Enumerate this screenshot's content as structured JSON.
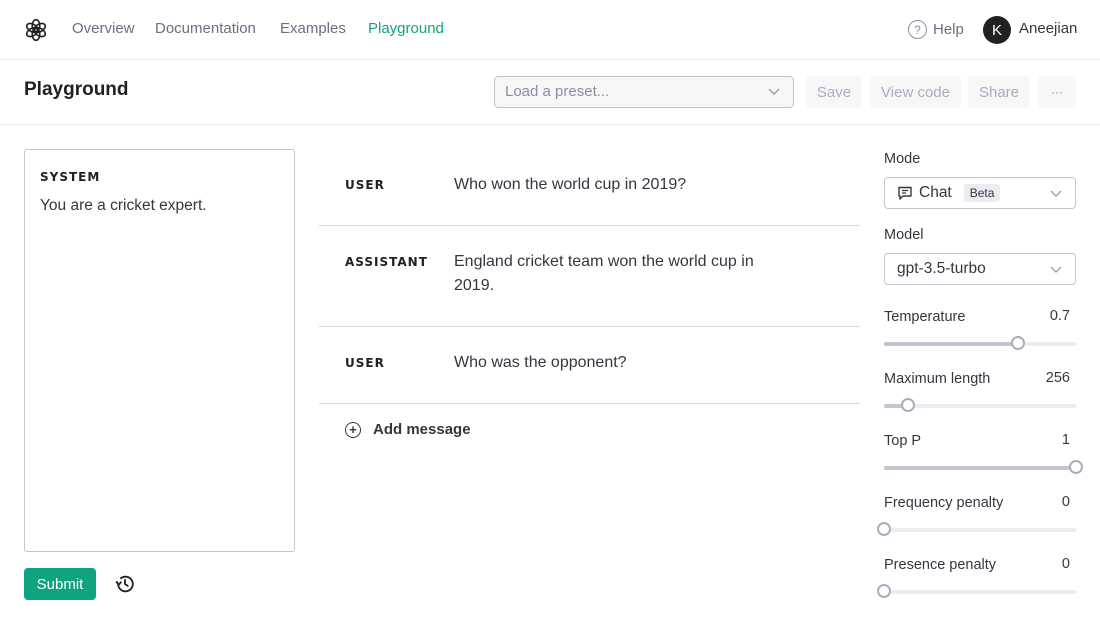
{
  "nav": {
    "links": [
      {
        "label": "Overview",
        "active": false
      },
      {
        "label": "Documentation",
        "active": false
      },
      {
        "label": "Examples",
        "active": false
      },
      {
        "label": "Playground",
        "active": true
      }
    ],
    "help_label": "Help",
    "user_initial": "K",
    "user_name": "Aneejian"
  },
  "header": {
    "title": "Playground",
    "preset_placeholder": "Load a preset...",
    "save_label": "Save",
    "view_code_label": "View code",
    "share_label": "Share",
    "more_label": "···"
  },
  "system": {
    "label": "SYSTEM",
    "text": "You are a cricket expert."
  },
  "messages": [
    {
      "role": "USER",
      "content": "Who won the world cup in 2019?"
    },
    {
      "role": "ASSISTANT",
      "content": "England cricket team won the world cup in 2019."
    },
    {
      "role": "USER",
      "content": "Who was the opponent?"
    }
  ],
  "add_message_label": "Add message",
  "submit_label": "Submit",
  "settings": {
    "mode_label": "Mode",
    "mode_value": "Chat",
    "mode_badge": "Beta",
    "model_label": "Model",
    "model_value": "gpt-3.5-turbo",
    "sliders": [
      {
        "name": "temperature",
        "label": "Temperature",
        "value": "0.7",
        "fraction": 0.7
      },
      {
        "name": "maximum-length",
        "label": "Maximum length",
        "value": "256",
        "fraction": 0.125
      },
      {
        "name": "top-p",
        "label": "Top P",
        "value": "1",
        "fraction": 1.0
      },
      {
        "name": "frequency-penalty",
        "label": "Frequency penalty",
        "value": "0",
        "fraction": 0.0
      },
      {
        "name": "presence-penalty",
        "label": "Presence penalty",
        "value": "0",
        "fraction": 0.0
      }
    ]
  },
  "colors": {
    "accent": "#10a37f",
    "text": "#353740",
    "muted": "#6e6e80"
  }
}
